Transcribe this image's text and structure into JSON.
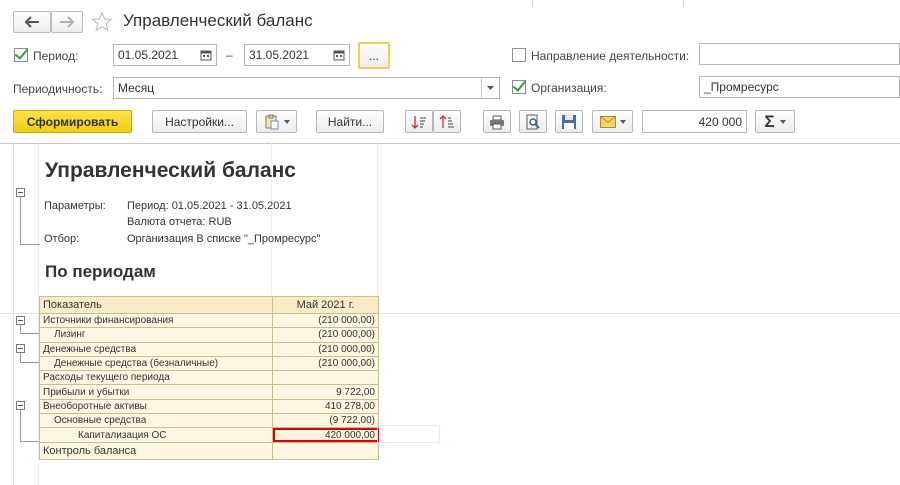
{
  "window": {
    "title": "Управленческий баланс"
  },
  "filters": {
    "period_label": "Период:",
    "date_from": "01.05.2021",
    "date_dash": "–",
    "date_to": "31.05.2021",
    "ellipsis": "...",
    "direction_label": "Направление деятельности:",
    "direction_value": "",
    "periodicity_label": "Периодичность:",
    "periodicity_value": "Месяц",
    "organization_label": "Организация:",
    "organization_value": "_Промресурс"
  },
  "toolbar": {
    "generate": "Сформировать",
    "settings": "Настройки...",
    "find": "Найти...",
    "sum_value": "420 000",
    "sigma": "Σ"
  },
  "report": {
    "title": "Управленческий баланс",
    "params_label": "Параметры:",
    "period_line": "Период: 01.05.2021 - 31.05.2021",
    "currency_line": "Валюта отчета: RUB",
    "filter_label": "Отбор:",
    "filter_value": "Организация В списке \"_Промресурс\"",
    "section_title": "По периодам",
    "col_indicator": "Показатель",
    "col_period": "Май 2021 г.",
    "rows": [
      {
        "label": "Источники финансирования",
        "value": "(210 000,00)"
      },
      {
        "label": "Лизинг",
        "value": "(210 000,00)"
      },
      {
        "label": "Денежные средства",
        "value": "(210 000,00)"
      },
      {
        "label": "Денежные средства (безналичные)",
        "value": "(210 000,00)"
      },
      {
        "label": "Расходы текущего периода",
        "value": ""
      },
      {
        "label": "Прибыли и убытки",
        "value": "9 722,00"
      },
      {
        "label": "Внеоборотные активы",
        "value": "410 278,00"
      },
      {
        "label": "Основные средства",
        "value": "(9 722,00)"
      },
      {
        "label": "Капитализация ОС",
        "value": "420 000,00"
      }
    ],
    "footer": "Контроль баланса"
  },
  "colors": {
    "generate_button": "#f5d320",
    "highlight": "#e00000",
    "check": "#3a9a3a"
  }
}
